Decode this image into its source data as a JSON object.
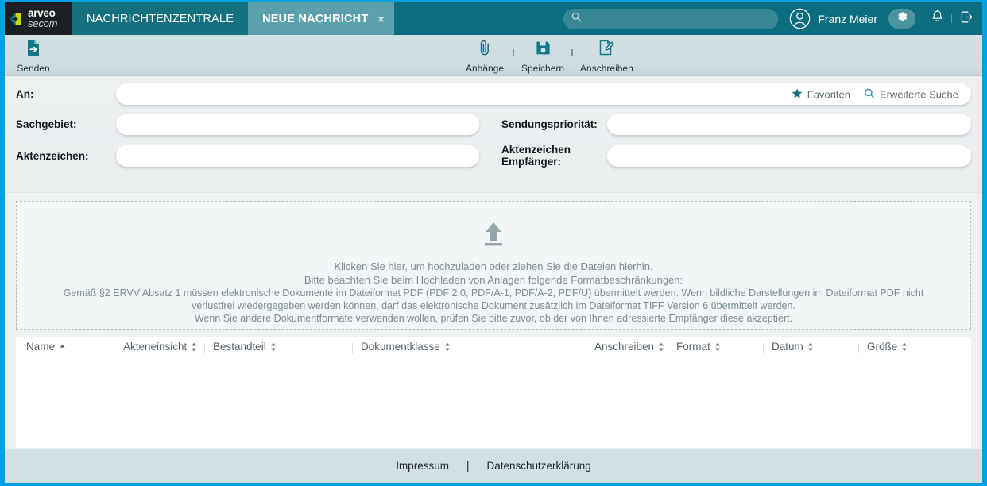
{
  "brand": {
    "name_primary": "arveo",
    "name_secondary": "secom",
    "accent_blue": "#00a0e3",
    "header_teal": "#0d6d80",
    "tab_active_teal": "#5ba0ab",
    "tab_inactive_teal": "#14707f"
  },
  "header": {
    "tabs": [
      {
        "label": "NACHRICHTENZENTRALE",
        "active": false
      },
      {
        "label": "NEUE NACHRICHT",
        "active": true,
        "close_label": "×"
      }
    ],
    "search": {
      "value": "",
      "placeholder": ""
    },
    "user_name": "Franz Meier",
    "icons": {
      "search": "search-icon",
      "avatar": "user-avatar-icon",
      "settings": "gear-icon",
      "notifications": "bell-icon",
      "logout": "logout-icon"
    }
  },
  "toolbar": {
    "send": {
      "label": "Senden",
      "icon": "document-send-icon"
    },
    "items": [
      {
        "label": "Anhänge",
        "icon": "paperclip-icon"
      },
      {
        "label": "Speichern",
        "icon": "floppy-disk-icon"
      },
      {
        "label": "Anschreiben",
        "icon": "document-edit-icon"
      }
    ]
  },
  "form": {
    "an": {
      "label": "An:",
      "value": "",
      "placeholder": ""
    },
    "favoriten": {
      "label": "Favoriten",
      "icon": "star-icon"
    },
    "erweiterte_suche": {
      "label": "Erweiterte Suche",
      "icon": "search-icon"
    },
    "sachgebiet": {
      "label": "Sachgebiet:",
      "value": "",
      "placeholder": ""
    },
    "sendungsprioritaet": {
      "label": "Sendungspriorität:",
      "value": "",
      "placeholder": ""
    },
    "aktenzeichen": {
      "label": "Aktenzeichen:",
      "value": "",
      "placeholder": ""
    },
    "aktenzeichen_empfaenger": {
      "label_line1": "Aktenzeichen",
      "label_line2": "Empfänger:",
      "value": "",
      "placeholder": ""
    }
  },
  "dropzone": {
    "icon": "upload-arrow-icon",
    "line1": "Klicken Sie hier, um hochzuladen oder ziehen Sie die Dateien hierhin.",
    "line2": "Bitte beachten Sie beim Hochladen von Anlagen folgende Formatbeschränkungen:",
    "line3": "Gemäß §2 ERVV Absatz 1 müssen elektronische Dokumente im Dateiformat PDF (PDF 2.0, PDF/A-1, PDF/A-2, PDF/U) übermittelt werden. Wenn bildliche Darstellungen im Dateiformat PDF nicht",
    "line4": "verlustfrei wiedergegeben werden können, darf das elektronische Dokument zusätzlich im Dateiformat TIFF Version 6 übermittelt werden.",
    "line5": "Wenn Sie andere Dokumentformate verwenden wollen, prüfen Sie bitte zuvor, ob der von Ihnen adressierte Empfänger diese akzeptiert."
  },
  "table": {
    "columns": [
      {
        "label": "Name",
        "sort": "asc",
        "divider": false
      },
      {
        "label": "Akteneinsicht",
        "sort": "none",
        "divider": false
      },
      {
        "label": "Bestandteil",
        "sort": "none",
        "divider": true
      },
      {
        "label": "Dokumentklasse",
        "sort": "none",
        "divider": true
      },
      {
        "label": "Anschreiben",
        "sort": "none",
        "divider": true
      },
      {
        "label": "Format",
        "sort": "none",
        "divider": true
      },
      {
        "label": "Datum",
        "sort": "none",
        "divider": true
      },
      {
        "label": "Größe",
        "sort": "none",
        "divider": true
      }
    ],
    "rows": []
  },
  "footer": {
    "impressum": "Impressum",
    "separator": "|",
    "datenschutz": "Datenschutzerklärung"
  }
}
